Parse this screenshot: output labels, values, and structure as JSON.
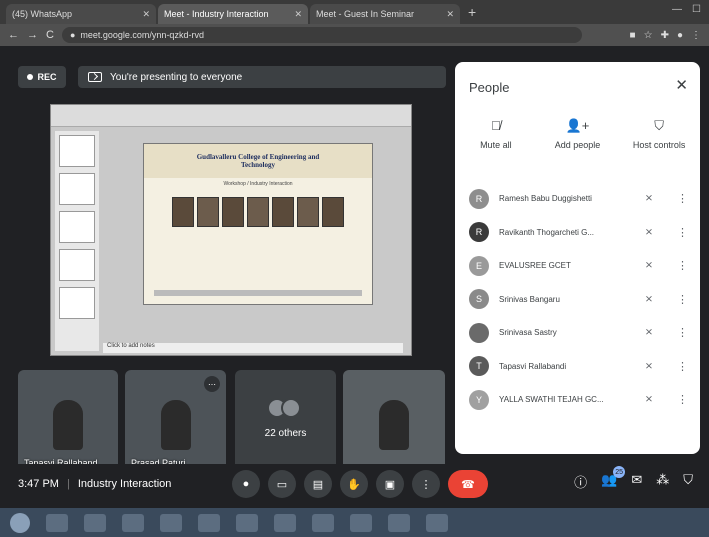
{
  "browser": {
    "tabs": [
      {
        "title": "(45) WhatsApp",
        "active": false
      },
      {
        "title": "Meet - Industry Interaction",
        "active": true
      },
      {
        "title": "Meet - Guest In Seminar",
        "active": false
      }
    ],
    "url": "meet.google.com/ynn-qzkd-rvd"
  },
  "meet": {
    "rec_label": "REC",
    "presenting_text": "You're presenting to everyone",
    "slide": {
      "title": "Gudlavalleru College of Engineering and Technology",
      "line1": "Workshop / Industry Interaction",
      "status": "Click to add notes"
    },
    "tiles": [
      {
        "name": "Tapasvi Rallaband",
        "type": "video"
      },
      {
        "name": "Prasad Paturi",
        "type": "video"
      },
      {
        "name": "22 others",
        "type": "others"
      },
      {
        "name": "",
        "type": "video"
      }
    ],
    "people_panel": {
      "title": "People",
      "actions": [
        {
          "label": "Mute all",
          "icon": "mic-off-icon"
        },
        {
          "label": "Add people",
          "icon": "person-add-icon"
        },
        {
          "label": "Host controls",
          "icon": "shield-icon"
        }
      ],
      "participants": [
        {
          "name": "Ramesh Babu Duggishetti",
          "initial": "R",
          "color": "#8e8e8e"
        },
        {
          "name": "Ravikanth Thogarcheti G...",
          "initial": "R",
          "color": "#3a3a3a"
        },
        {
          "name": "EVALUSREE GCET",
          "initial": "E",
          "color": "#9a9a9a"
        },
        {
          "name": "Srinivas Bangaru",
          "initial": "S",
          "color": "#8a8a8a"
        },
        {
          "name": "Srinivasa Sastry",
          "initial": "",
          "color": "#6a6a6a"
        },
        {
          "name": "Tapasvi Rallabandi",
          "initial": "T",
          "color": "#5a5a5a"
        },
        {
          "name": "YALLA SWATHI TEJAH GC...",
          "initial": "Y",
          "color": "#a0a0a0"
        }
      ]
    },
    "bottom": {
      "time": "3:47 PM",
      "meeting_name": "Industry Interaction",
      "people_count": "25"
    }
  },
  "colors": {
    "meet_bg": "#202124",
    "end_call": "#ea4335",
    "accent": "#8ab4f8"
  }
}
